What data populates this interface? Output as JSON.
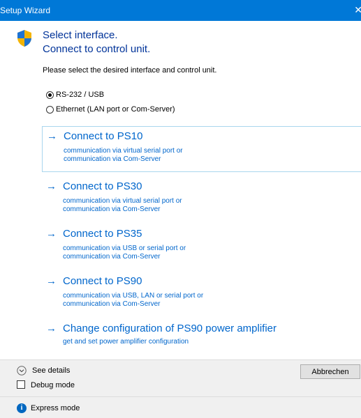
{
  "window": {
    "title": "Setup Wizard",
    "close_glyph": "✕"
  },
  "header": {
    "shield_icon": "uac-shield-icon",
    "line1": "Select interface.",
    "line2": "Connect to control unit."
  },
  "instruction": "Please select the desired interface and control unit.",
  "interfaces": [
    {
      "label": "RS-232 / USB",
      "selected": true
    },
    {
      "label": "Ethernet (LAN port or Com-Server)",
      "selected": false
    }
  ],
  "commands": [
    {
      "arrow": "→",
      "title": "Connect to PS10",
      "desc1": "communication via virtual serial port or",
      "desc2": "communication via Com-Server"
    },
    {
      "arrow": "→",
      "title": "Connect to PS30",
      "desc1": "communication via virtual serial port or",
      "desc2": "communication via Com-Server"
    },
    {
      "arrow": "→",
      "title": "Connect to PS35",
      "desc1": "communication via USB or serial port or",
      "desc2": "communication via Com-Server"
    },
    {
      "arrow": "→",
      "title": "Connect to PS90",
      "desc1": "communication via USB, LAN or serial port or",
      "desc2": "communication via Com-Server"
    },
    {
      "arrow": "→",
      "title": "Change configuration of PS90 power amplifier",
      "desc1": "get and set power amplifier configuration"
    }
  ],
  "footer": {
    "see_details": "See details",
    "cancel": "Abbrechen",
    "debug_mode": "Debug mode",
    "debug_checked": false,
    "info_glyph": "i",
    "express_mode": "Express mode"
  },
  "colors": {
    "titlebar": "#0078d7",
    "heading": "#003399",
    "link": "#0066cc",
    "footer": "#f0f0f0"
  }
}
